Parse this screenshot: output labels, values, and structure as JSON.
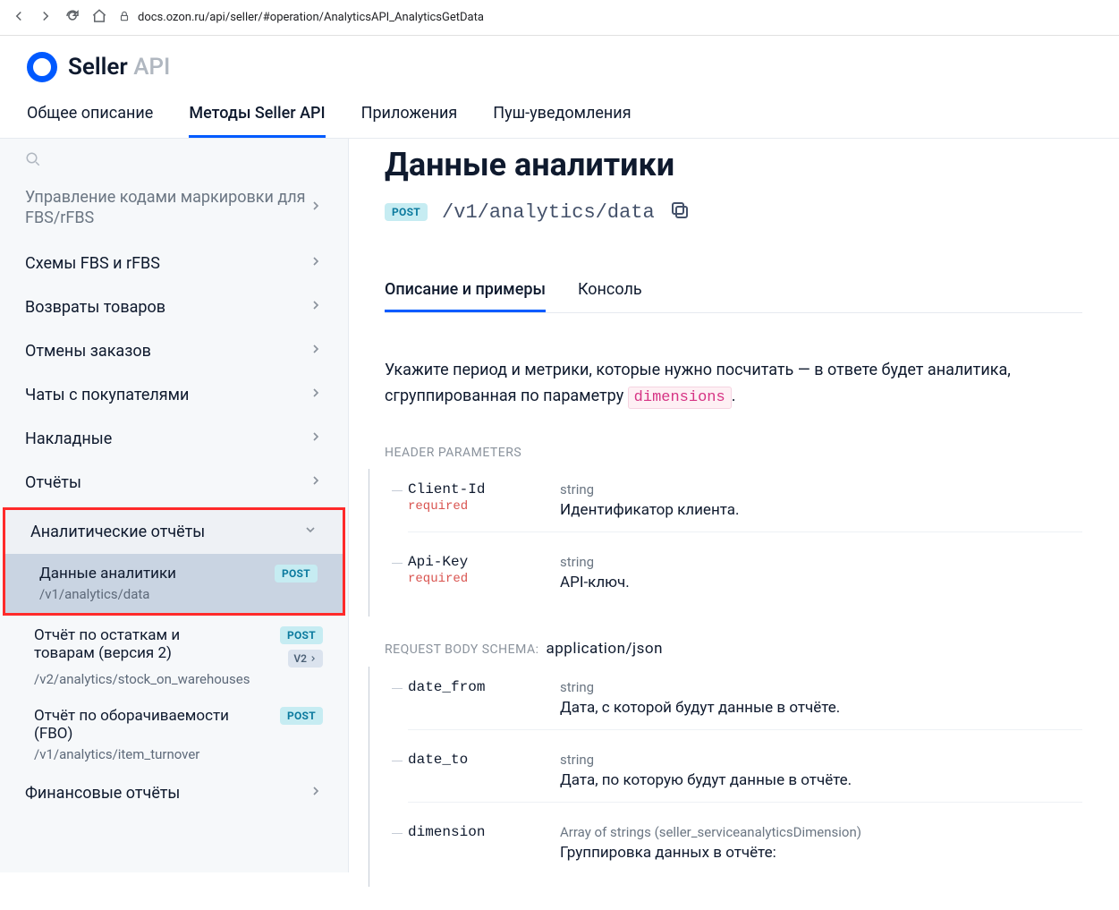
{
  "browser": {
    "url": "docs.ozon.ru/api/seller/#operation/AnalyticsAPI_AnalyticsGetData"
  },
  "logo": {
    "seller": "Seller ",
    "api": "API"
  },
  "nav": {
    "items": [
      "Общее описание",
      "Методы Seller API",
      "Приложения",
      "Пуш-уведомления"
    ],
    "active_index": 1
  },
  "sidebar": {
    "truncated_top": "Управление кодами маркировки для FBS/rFBS",
    "items": [
      "Схемы FBS и rFBS",
      "Возвраты товаров",
      "Отмены заказов",
      "Чаты с покупателями",
      "Накладные",
      "Отчёты"
    ],
    "expanded": {
      "label": "Аналитические отчёты",
      "active": {
        "title": "Данные аналитики",
        "path": "/v1/analytics/data",
        "badge": "POST"
      },
      "sub2": {
        "title": "Отчёт по остаткам и товарам (версия 2)",
        "path": "/v2/analytics/stock_on_warehouses",
        "badge": "POST",
        "v2": "V2"
      },
      "sub3": {
        "title": "Отчёт по оборачиваемости (FBO)",
        "path": "/v1/analytics/item_turnover",
        "badge": "POST"
      }
    },
    "last": "Финансовые отчёты"
  },
  "main": {
    "title": "Данные аналитики",
    "method_badge": "POST",
    "endpoint": "/v1/analytics/data",
    "tabs": {
      "t1": "Описание и примеры",
      "t2": "Консоль"
    },
    "description_pre": "Укажите период и метрики, которые нужно посчитать — в ответе будет аналитика, сгруппированная по параметру ",
    "description_code": "dimensions",
    "description_post": ".",
    "header_params_label": "HEADER PARAMETERS",
    "header_params": [
      {
        "name": "Client-Id",
        "required": "required",
        "type": "string",
        "desc": "Идентификатор клиента."
      },
      {
        "name": "Api-Key",
        "required": "required",
        "type": "string",
        "desc": "API-ключ."
      }
    ],
    "body_label": "REQUEST BODY SCHEMA:",
    "body_value": "application/json",
    "body_params": [
      {
        "name": "date_from",
        "type": "string",
        "desc": "Дата, с которой будут данные в отчёте."
      },
      {
        "name": "date_to",
        "type": "string",
        "desc": "Дата, по которую будут данные в отчёте."
      },
      {
        "name": "dimension",
        "type": "Array of strings (seller_serviceanalyticsDimension)",
        "desc": "Группировка данных в отчёте:"
      }
    ]
  }
}
